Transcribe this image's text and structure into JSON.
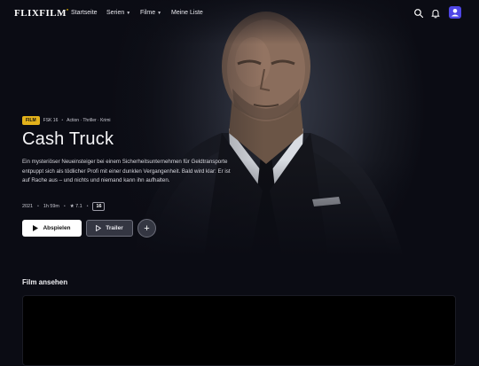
{
  "brand": {
    "logo": "FLIXFILM"
  },
  "nav": {
    "items": [
      {
        "label": "Startseite",
        "dropdown": false
      },
      {
        "label": "Serien",
        "dropdown": true
      },
      {
        "label": "Filme",
        "dropdown": true
      },
      {
        "label": "Meine Liste",
        "dropdown": false
      }
    ],
    "icons": [
      "search-icon",
      "bell-icon",
      "user-icon"
    ]
  },
  "hero": {
    "type_tag": "FILM",
    "age_rating": "FSK 16",
    "genres": "Action · Thriller · Krimi",
    "title": "Cash Truck",
    "description": "Ein mysteriöser Neueinsteiger bei einem Sicherheitsunternehmen für Geldtransporte entpuppt sich als tödlicher Profi mit einer dunklen Vergangenheit. Bald wird klar: Er ist auf Rache aus – und nichts und niemand kann ihn aufhalten.",
    "year": "2021",
    "duration": "1h 59m",
    "rating": "★ 7.1",
    "age_badge": "16",
    "play_label": "Abspielen",
    "trailer_label": "Trailer",
    "add_label": "+"
  },
  "watch_section": {
    "title": "Film ansehen"
  },
  "colors": {
    "accent": "#e3b21b",
    "avatar": "#4f46e5",
    "background": "#0b0c14"
  }
}
